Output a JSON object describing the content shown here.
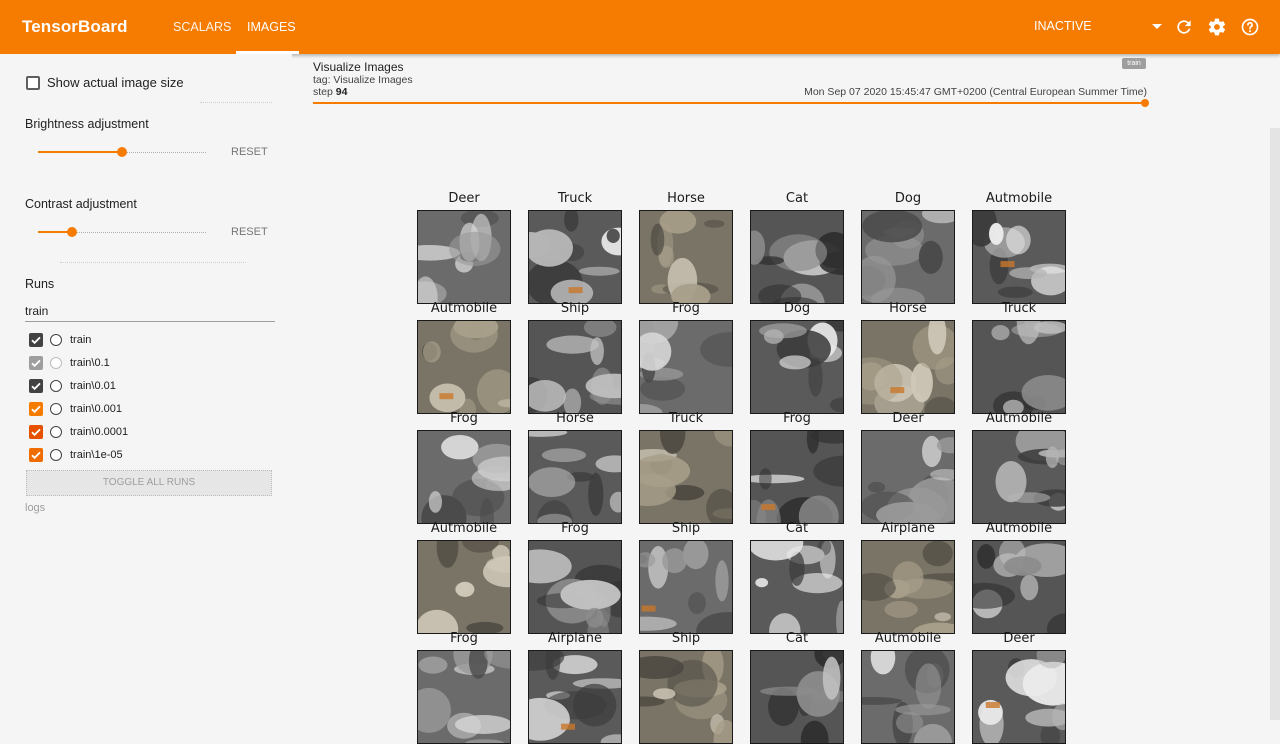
{
  "app": {
    "title": "TensorBoard"
  },
  "tabs": [
    {
      "label": "SCALARS",
      "active": false
    },
    {
      "label": "IMAGES",
      "active": true
    }
  ],
  "status": {
    "label": "INACTIVE"
  },
  "sidebar": {
    "show_actual_size_label": "Show actual image size",
    "brightness": {
      "label": "Brightness adjustment",
      "value": 0.5,
      "reset_label": "RESET"
    },
    "contrast": {
      "label": "Contrast adjustment",
      "value": 0.2,
      "reset_label": "RESET"
    },
    "runs_label": "Runs",
    "runs_filter_value": "train",
    "runs": [
      {
        "label": "train",
        "checked": true,
        "color": "#424242"
      },
      {
        "label": "train\\0.1",
        "checked": true,
        "color": "#9e9e9e"
      },
      {
        "label": "train\\0.01",
        "checked": true,
        "color": "#424242"
      },
      {
        "label": "train\\0.001",
        "checked": true,
        "color": "#f57c00"
      },
      {
        "label": "train\\0.0001",
        "checked": true,
        "color": "#e65100"
      },
      {
        "label": "train\\1e-05",
        "checked": true,
        "color": "#ef6c00"
      }
    ],
    "toggle_all_label": "TOGGLE ALL RUNS",
    "logdir": "logs"
  },
  "card": {
    "title": "Visualize Images",
    "tag": "tag: Visualize Images",
    "step_label": "step",
    "step_value": "94",
    "timestamp": "Mon Sep 07 2020 15:45:47 GMT+0200 (Central European Summer Time)",
    "run_chip": "train"
  },
  "image_grid": {
    "labels": [
      [
        "Deer",
        "Truck",
        "Horse",
        "Cat",
        "Dog",
        "Autmobile"
      ],
      [
        "Autmobile",
        "Ship",
        "Frog",
        "Dog",
        "Horse",
        "Truck"
      ],
      [
        "Frog",
        "Horse",
        "Truck",
        "Frog",
        "Deer",
        "Autmobile"
      ],
      [
        "Autmobile",
        "Frog",
        "Ship",
        "Cat",
        "Airplane",
        "Autmobile"
      ],
      [
        "Frog",
        "Airplane",
        "Ship",
        "Cat",
        "Autmobile",
        "Deer"
      ]
    ]
  },
  "colors": {
    "accent": "#f57c00",
    "header_text": "#ffffff"
  }
}
